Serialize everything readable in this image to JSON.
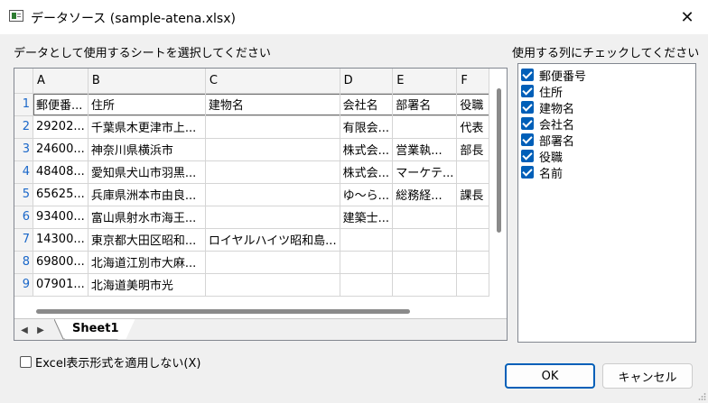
{
  "window": {
    "title": "データソース (sample-atena.xlsx)"
  },
  "labels": {
    "sheet_prompt": "データとして使用するシートを選択してください",
    "columns_prompt": "使用する列にチェックしてください"
  },
  "grid": {
    "column_letters": [
      "A",
      "B",
      "C",
      "D",
      "E",
      "F"
    ],
    "rows": [
      {
        "num": "1",
        "cells": [
          "郵便番...",
          "住所",
          "建物名",
          "会社名",
          "部署名",
          "役職"
        ]
      },
      {
        "num": "2",
        "cells": [
          "29202...",
          "千葉県木更津市上...",
          "",
          "有限会...",
          "",
          "代表"
        ]
      },
      {
        "num": "3",
        "cells": [
          "24600...",
          "神奈川県横浜市",
          "",
          "株式会...",
          "営業執...",
          "部長"
        ]
      },
      {
        "num": "4",
        "cells": [
          "48408...",
          "愛知県犬山市羽黒...",
          "",
          "株式会...",
          "マーケテ...",
          ""
        ]
      },
      {
        "num": "5",
        "cells": [
          "65625...",
          "兵庫県洲本市由良...",
          "",
          "ゆ〜ら...",
          "総務経...",
          "課長"
        ]
      },
      {
        "num": "6",
        "cells": [
          "93400...",
          "富山県射水市海王...",
          "",
          "建築士...",
          "",
          ""
        ]
      },
      {
        "num": "7",
        "cells": [
          "14300...",
          "東京都大田区昭和...",
          "ロイヤルハイツ昭和島...",
          "",
          "",
          ""
        ]
      },
      {
        "num": "8",
        "cells": [
          "69800...",
          "北海道江別市大麻...",
          "",
          "",
          "",
          ""
        ]
      },
      {
        "num": "9",
        "cells": [
          "07901...",
          "北海道美明市光",
          "",
          "",
          "",
          ""
        ]
      }
    ],
    "sheet_tab": "Sheet1"
  },
  "column_list": {
    "items": [
      {
        "label": "郵便番号",
        "checked": true
      },
      {
        "label": "住所",
        "checked": true
      },
      {
        "label": "建物名",
        "checked": true
      },
      {
        "label": "会社名",
        "checked": true
      },
      {
        "label": "部署名",
        "checked": true
      },
      {
        "label": "役職",
        "checked": true
      },
      {
        "label": "名前",
        "checked": true
      }
    ]
  },
  "options": {
    "excel_format_label": "Excel表示形式を適用しない(X)",
    "excel_format_checked": false
  },
  "buttons": {
    "ok": "OK",
    "cancel": "キャンセル"
  },
  "icons": {
    "app": "excel-data-icon",
    "close": "close-icon",
    "scroll_left": "triangle-left-icon",
    "scroll_right": "triangle-right-icon",
    "grip": "resize-grip-icon"
  },
  "colors": {
    "accent": "#005fb8",
    "row_number": "#1a67c9"
  }
}
